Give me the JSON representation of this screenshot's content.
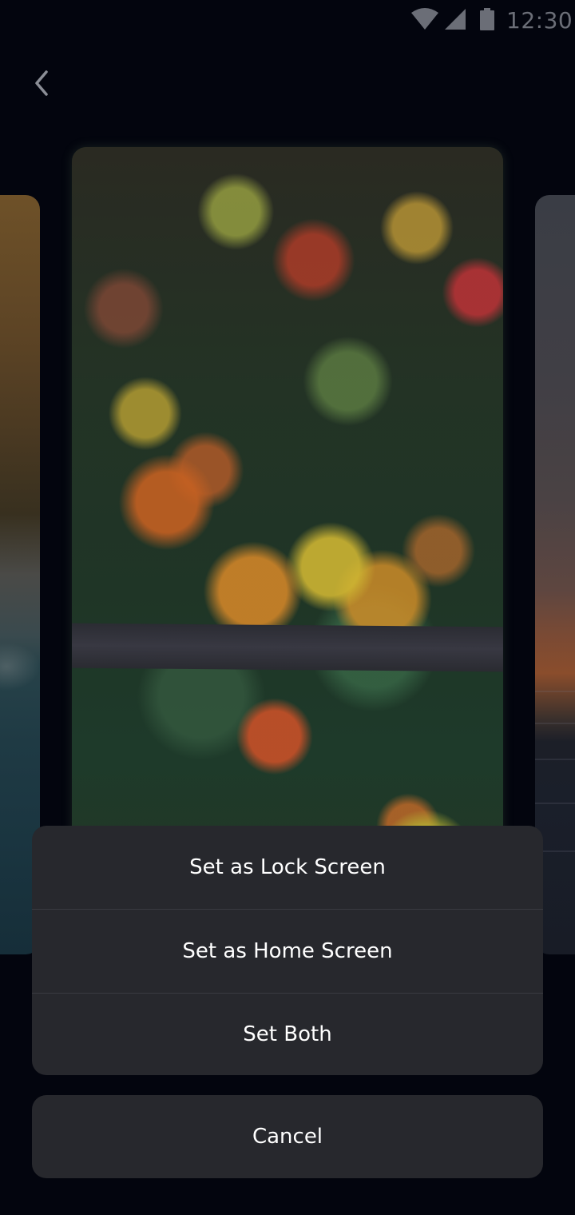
{
  "status_bar": {
    "time": "12:30",
    "icons": [
      "wifi-icon",
      "signal-icon",
      "battery-icon"
    ]
  },
  "navigation": {
    "back_icon": "chevron-left-icon"
  },
  "previews": {
    "left": "beach-wallpaper-preview",
    "center": "autumn-forest-wallpaper-preview",
    "right": "sunset-sea-wallpaper-preview"
  },
  "action_sheet": {
    "options": [
      {
        "label": "Set as Lock Screen"
      },
      {
        "label": "Set as Home Screen"
      },
      {
        "label": "Set Both"
      }
    ],
    "cancel_label": "Cancel"
  },
  "colors": {
    "background": "#03050e",
    "sheet_background": "#27282d",
    "sheet_text": "#ffffff",
    "divider": "#3a3b41",
    "status_icons": "#6b6e77"
  }
}
